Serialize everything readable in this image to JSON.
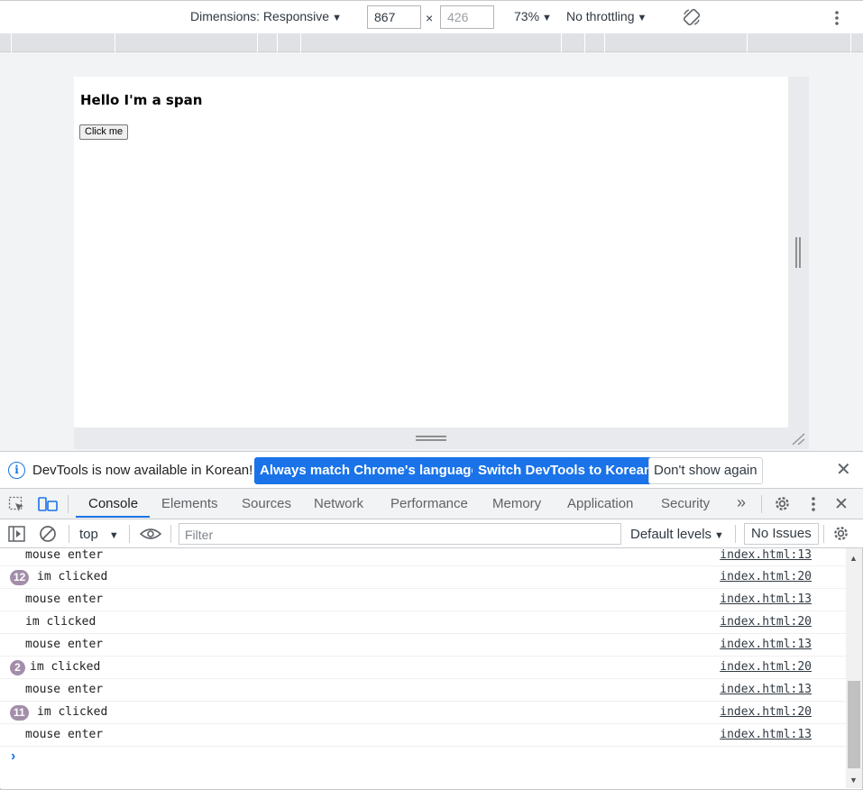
{
  "device_toolbar": {
    "dimensions_label": "Dimensions: Responsive",
    "width_value": "867",
    "height_placeholder": "426",
    "times": "×",
    "zoom": "73%",
    "throttling": "No throttling",
    "rotate_icon": "rotate-icon",
    "more_icon": "more-vert-icon"
  },
  "page": {
    "span_text": "Hello I'm a span",
    "button_label": "Click me"
  },
  "infobar": {
    "message": "DevTools is now available in Korean!",
    "match_button": "Always match Chrome's language",
    "switch_button": "Switch DevTools to Korean",
    "dismiss_button": "Don't show again",
    "close_icon": "close-icon"
  },
  "tabs": {
    "items": [
      "Console",
      "Elements",
      "Sources",
      "Network",
      "Performance",
      "Memory",
      "Application",
      "Security"
    ],
    "more": "»",
    "active": "Console"
  },
  "console_toolbar": {
    "context": "top",
    "filter_placeholder": "Filter",
    "levels": "Default levels",
    "issues": "No Issues"
  },
  "console": {
    "rows": [
      {
        "msg": "mouse enter",
        "link": "index.html:13",
        "count": ""
      },
      {
        "msg": "im clicked",
        "link": "index.html:20",
        "count": "12"
      },
      {
        "msg": "mouse enter",
        "link": "index.html:13",
        "count": ""
      },
      {
        "msg": "im clicked",
        "link": "index.html:20",
        "count": ""
      },
      {
        "msg": "mouse enter",
        "link": "index.html:13",
        "count": ""
      },
      {
        "msg": "im clicked",
        "link": "index.html:20",
        "count": "2"
      },
      {
        "msg": "mouse enter",
        "link": "index.html:13",
        "count": ""
      },
      {
        "msg": "im clicked",
        "link": "index.html:20",
        "count": "11"
      },
      {
        "msg": "mouse enter",
        "link": "index.html:13",
        "count": ""
      }
    ],
    "prompt": "›"
  },
  "colors": {
    "accent": "#1a73e8",
    "badge": "#a38eaa"
  }
}
